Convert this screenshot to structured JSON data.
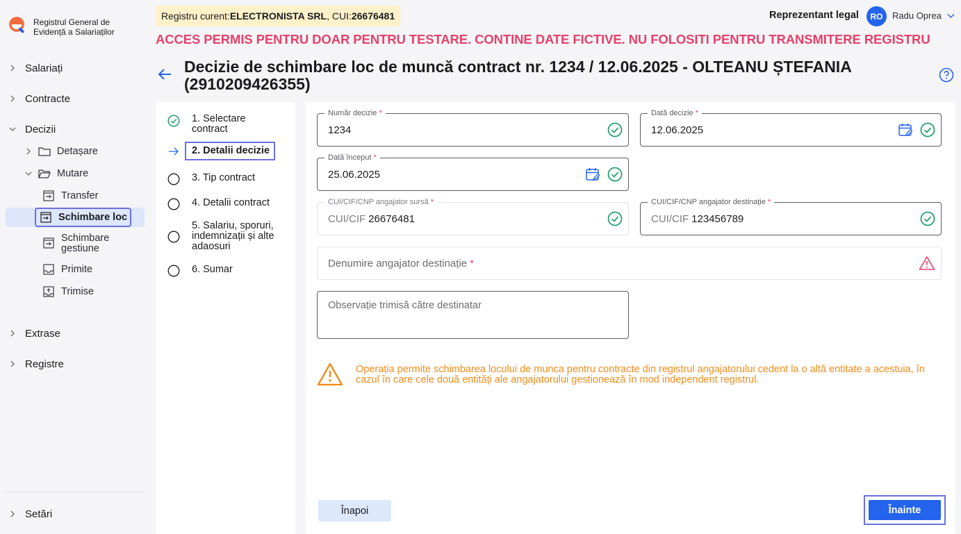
{
  "app": {
    "logo_text": "Registrul General de Evidență a Salariaților",
    "registry_prefix": "Registru curent: ",
    "registry_name": "ELECTRONISTA SRL",
    "cui_prefix": ", CUI: ",
    "cui_value": "26676481",
    "role": "Reprezentant legal",
    "user_initials": "RO",
    "user_name": "Radu Oprea",
    "warning": "ACCES PERMIS PENTRU DOAR PENTRU TESTARE. CONTINE DATE FICTIVE. NU FOLOSITI PENTRU TRANSMITERE REGISTRU"
  },
  "sidebar": {
    "salariati": "Salariați",
    "contracte": "Contracte",
    "decizii": "Decizii",
    "detasare": "Detașare",
    "mutare": "Mutare",
    "transfer": "Transfer",
    "schimbare_loc": "Schimbare loc",
    "schimbare_gestiune": "Schimbare gestiune",
    "primite": "Primite",
    "trimise": "Trimise",
    "extrase": "Extrase",
    "registre": "Registre",
    "setari": "Setări"
  },
  "page": {
    "title": "Decizie de schimbare loc de muncă contract nr. 1234 / 12.06.2025 - OLTEANU  ȘTEFANIA (2910209426355)"
  },
  "steps": [
    {
      "label": "1. Selectare contract",
      "state": "done"
    },
    {
      "label": "2. Detalii decizie",
      "state": "current"
    },
    {
      "label": "3. Tip contract",
      "state": "todo"
    },
    {
      "label": "4. Detalii contract",
      "state": "todo"
    },
    {
      "label": "5. Salariu, sporuri, indemnizații și alte adaosuri",
      "state": "todo"
    },
    {
      "label": "6. Sumar",
      "state": "todo"
    }
  ],
  "form": {
    "numar_decizie": {
      "label": "Număr decizie",
      "value": "1234"
    },
    "data_decizie": {
      "label": "Dată decizie",
      "value": "12.06.2025"
    },
    "data_inceput": {
      "label": "Dată început",
      "value": "25.06.2025"
    },
    "cui_sursa": {
      "label": "CUI/CIF/CNP angajator sursă",
      "prefix": "CUI/CIF",
      "value": "26676481"
    },
    "cui_destinatie": {
      "label": "CUI/CIF/CNP angajator destinație",
      "prefix": "CUI/CIF",
      "value": "123456789"
    },
    "denumire_destinatie": {
      "placeholder": "Denumire angajator destinație"
    },
    "observatie": {
      "placeholder": "Observație trimisă către destinatar"
    },
    "required_mark": "*"
  },
  "info": "Operația permite schimbarea locului de munca pentru contracte din registrul angajatorului cedent la o altă entitate a acestuia, în cazul în care cele două entități ale angajatorului gestionează în mod independent registrul.",
  "buttons": {
    "back": "Înapoi",
    "next": "Înainte"
  },
  "colors": {
    "accent": "#2463eb",
    "success": "#1f9d6b",
    "danger": "#e5416b",
    "warning": "#f28c1b"
  }
}
